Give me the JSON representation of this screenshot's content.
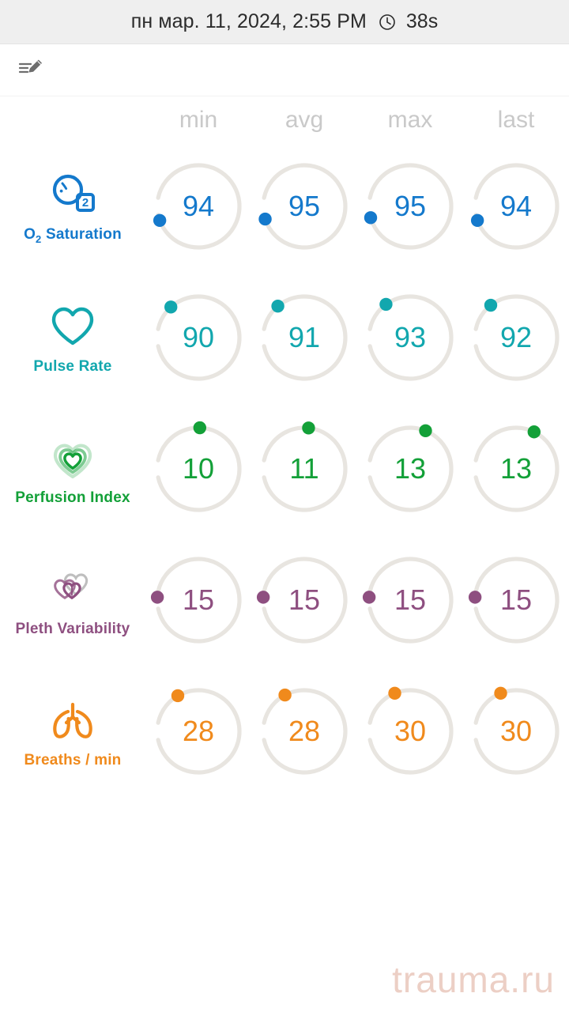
{
  "header": {
    "title": "пн мар. 11, 2024, 2:55 PM",
    "clock_icon": "clock-icon",
    "seconds": "38s",
    "background": "#efefef"
  },
  "toolbar": {
    "edit_icon": "edit-annotate-icon"
  },
  "columns": [
    "min",
    "avg",
    "max",
    "last"
  ],
  "column_header_color": "#c9c9c9",
  "track_color": "#e8e5e0",
  "metrics": [
    {
      "name": "O₂ Saturation",
      "name_plain": "O2 Saturation",
      "icon": "oxygen-bubble-icon",
      "color": "#1479cc",
      "values": [
        "94",
        "95",
        "95",
        "94"
      ],
      "dot_angles": [
        250,
        252,
        254,
        250
      ]
    },
    {
      "name": "Pulse Rate",
      "name_plain": "Pulse Rate",
      "icon": "heart-outline-icon",
      "color": "#12a7ae",
      "values": [
        "90",
        "91",
        "93",
        "92"
      ],
      "dot_angles": [
        318,
        320,
        324,
        322
      ]
    },
    {
      "name": "Perfusion Index",
      "name_plain": "Perfusion Index",
      "icon": "nested-hearts-icon",
      "color": "#13a038",
      "values": [
        "10",
        "11",
        "13",
        "13"
      ],
      "dot_angles": [
        2,
        6,
        22,
        26
      ]
    },
    {
      "name": "Pleth Variability",
      "name_plain": "Pleth Variability",
      "icon": "overlapping-hearts-icon",
      "color": "#8e4f80",
      "values": [
        "15",
        "15",
        "15",
        "15"
      ],
      "dot_angles": [
        274,
        274,
        274,
        274
      ]
    },
    {
      "name": "Breaths / min",
      "name_plain": "Breaths / min",
      "icon": "lungs-icon",
      "color": "#f08a1c",
      "values": [
        "28",
        "28",
        "30",
        "30"
      ],
      "dot_angles": [
        330,
        332,
        338,
        338
      ]
    }
  ],
  "watermark": {
    "text": "trauma.ru",
    "color": "#eccfc5"
  }
}
